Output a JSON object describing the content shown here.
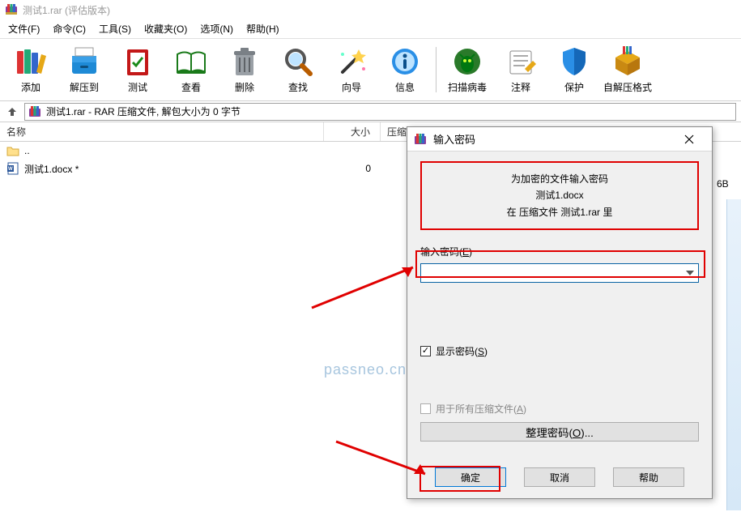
{
  "titlebar": {
    "title": "测试1.rar (评估版本)"
  },
  "menu": {
    "file": "文件(F)",
    "commands": "命令(C)",
    "tools": "工具(S)",
    "favorites": "收藏夹(O)",
    "options": "选项(N)",
    "help": "帮助(H)"
  },
  "toolbar": {
    "add": "添加",
    "extract_to": "解压到",
    "test": "测试",
    "view": "查看",
    "delete": "删除",
    "find": "查找",
    "wizard": "向导",
    "info": "信息",
    "virus_scan": "扫描病毒",
    "comment": "注释",
    "protect": "保护",
    "sfx": "自解压格式"
  },
  "path": {
    "text": "测试1.rar - RAR 压缩文件, 解包大小为 0 字节"
  },
  "columns": {
    "name": "名称",
    "size": "大小",
    "compressed": "压缩"
  },
  "files": {
    "up": "..",
    "item1_name": "测试1.docx *",
    "item1_size": "0"
  },
  "side_text": "6B",
  "watermark": "passneo.cn",
  "dialog": {
    "title": "输入密码",
    "prompt_line1": "为加密的文件输入密码",
    "prompt_line2": "测试1.docx",
    "prompt_line3": "在 压缩文件 测试1.rar 里",
    "input_label_pre": "输入密码(",
    "input_label_u": "E",
    "input_label_post": ")",
    "show_pw_pre": "显示密码(",
    "show_pw_u": "S",
    "show_pw_post": ")",
    "use_all_pre": "用于所有压缩文件(",
    "use_all_u": "A",
    "use_all_post": ")",
    "organize_pre": "整理密码(",
    "organize_u": "O",
    "organize_post": ")...",
    "ok": "确定",
    "cancel": "取消",
    "help": "帮助"
  }
}
